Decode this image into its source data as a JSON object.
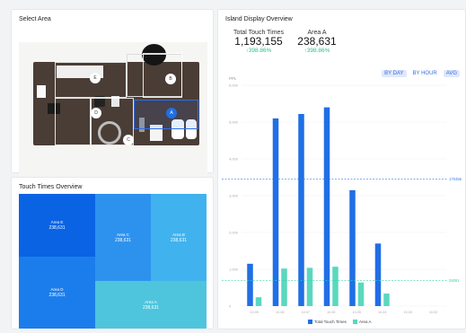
{
  "select_area": {
    "title": "Select Area",
    "markers": [
      {
        "id": "E",
        "selected": false
      },
      {
        "id": "B",
        "selected": false
      },
      {
        "id": "D",
        "selected": false
      },
      {
        "id": "A",
        "selected": true
      },
      {
        "id": "C",
        "selected": false
      }
    ]
  },
  "touch_overview": {
    "title": "Touch Times Overview",
    "cells": [
      {
        "name": "Area E",
        "value": "238,631",
        "color": "#0a63e3"
      },
      {
        "name": "Area C",
        "value": "238,631",
        "color": "#2d92ee"
      },
      {
        "name": "Area B",
        "value": "238,631",
        "color": "#40b2ee"
      },
      {
        "name": "Area D",
        "value": "238,631",
        "color": "#1b7deb"
      },
      {
        "name": "Area A",
        "value": "238,631",
        "color": "#4ec5dd"
      }
    ]
  },
  "island": {
    "title": "Island Display Overview",
    "total_label": "Total Touch Times",
    "total_value": "1,193,155",
    "total_change": "↑398.86%",
    "area_label": "Area A",
    "area_value": "238,631",
    "area_change": "↑398.86%",
    "toggles": [
      {
        "label": "BY DAY",
        "active": true
      },
      {
        "label": "BY HOUR",
        "active": false
      },
      {
        "label": "AVG",
        "active": true
      }
    ]
  },
  "colors": {
    "total": "#1f6fe6",
    "area": "#5ad8be"
  },
  "chart_data": {
    "type": "bar",
    "ylabel": "PPL",
    "ylim": [
      0,
      6000
    ],
    "yticks": [
      "0",
      "1,000",
      "2,000",
      "3,000",
      "4,000",
      "5,000",
      "6,000"
    ],
    "categories": [
      "10.09",
      "10.08",
      "10.07",
      "10.06",
      "10.05",
      "10.04",
      "10.03",
      "10.02"
    ],
    "series": [
      {
        "name": "Total Touch Times",
        "values": [
          1150,
          5100,
          5220,
          5400,
          3150,
          1700,
          0,
          0
        ],
        "color": "#1f6fe6"
      },
      {
        "name": "Area A",
        "values": [
          240,
          1020,
          1040,
          1070,
          640,
          340,
          0,
          0
        ],
        "color": "#5ad8be"
      }
    ],
    "reference_lines": [
      {
        "value": 3450,
        "label": "170456",
        "color": "#3a7be8"
      },
      {
        "value": 690,
        "label": "34091",
        "color": "#3cd0a8"
      }
    ],
    "legend": [
      "Total Touch Times",
      "Area A"
    ]
  }
}
